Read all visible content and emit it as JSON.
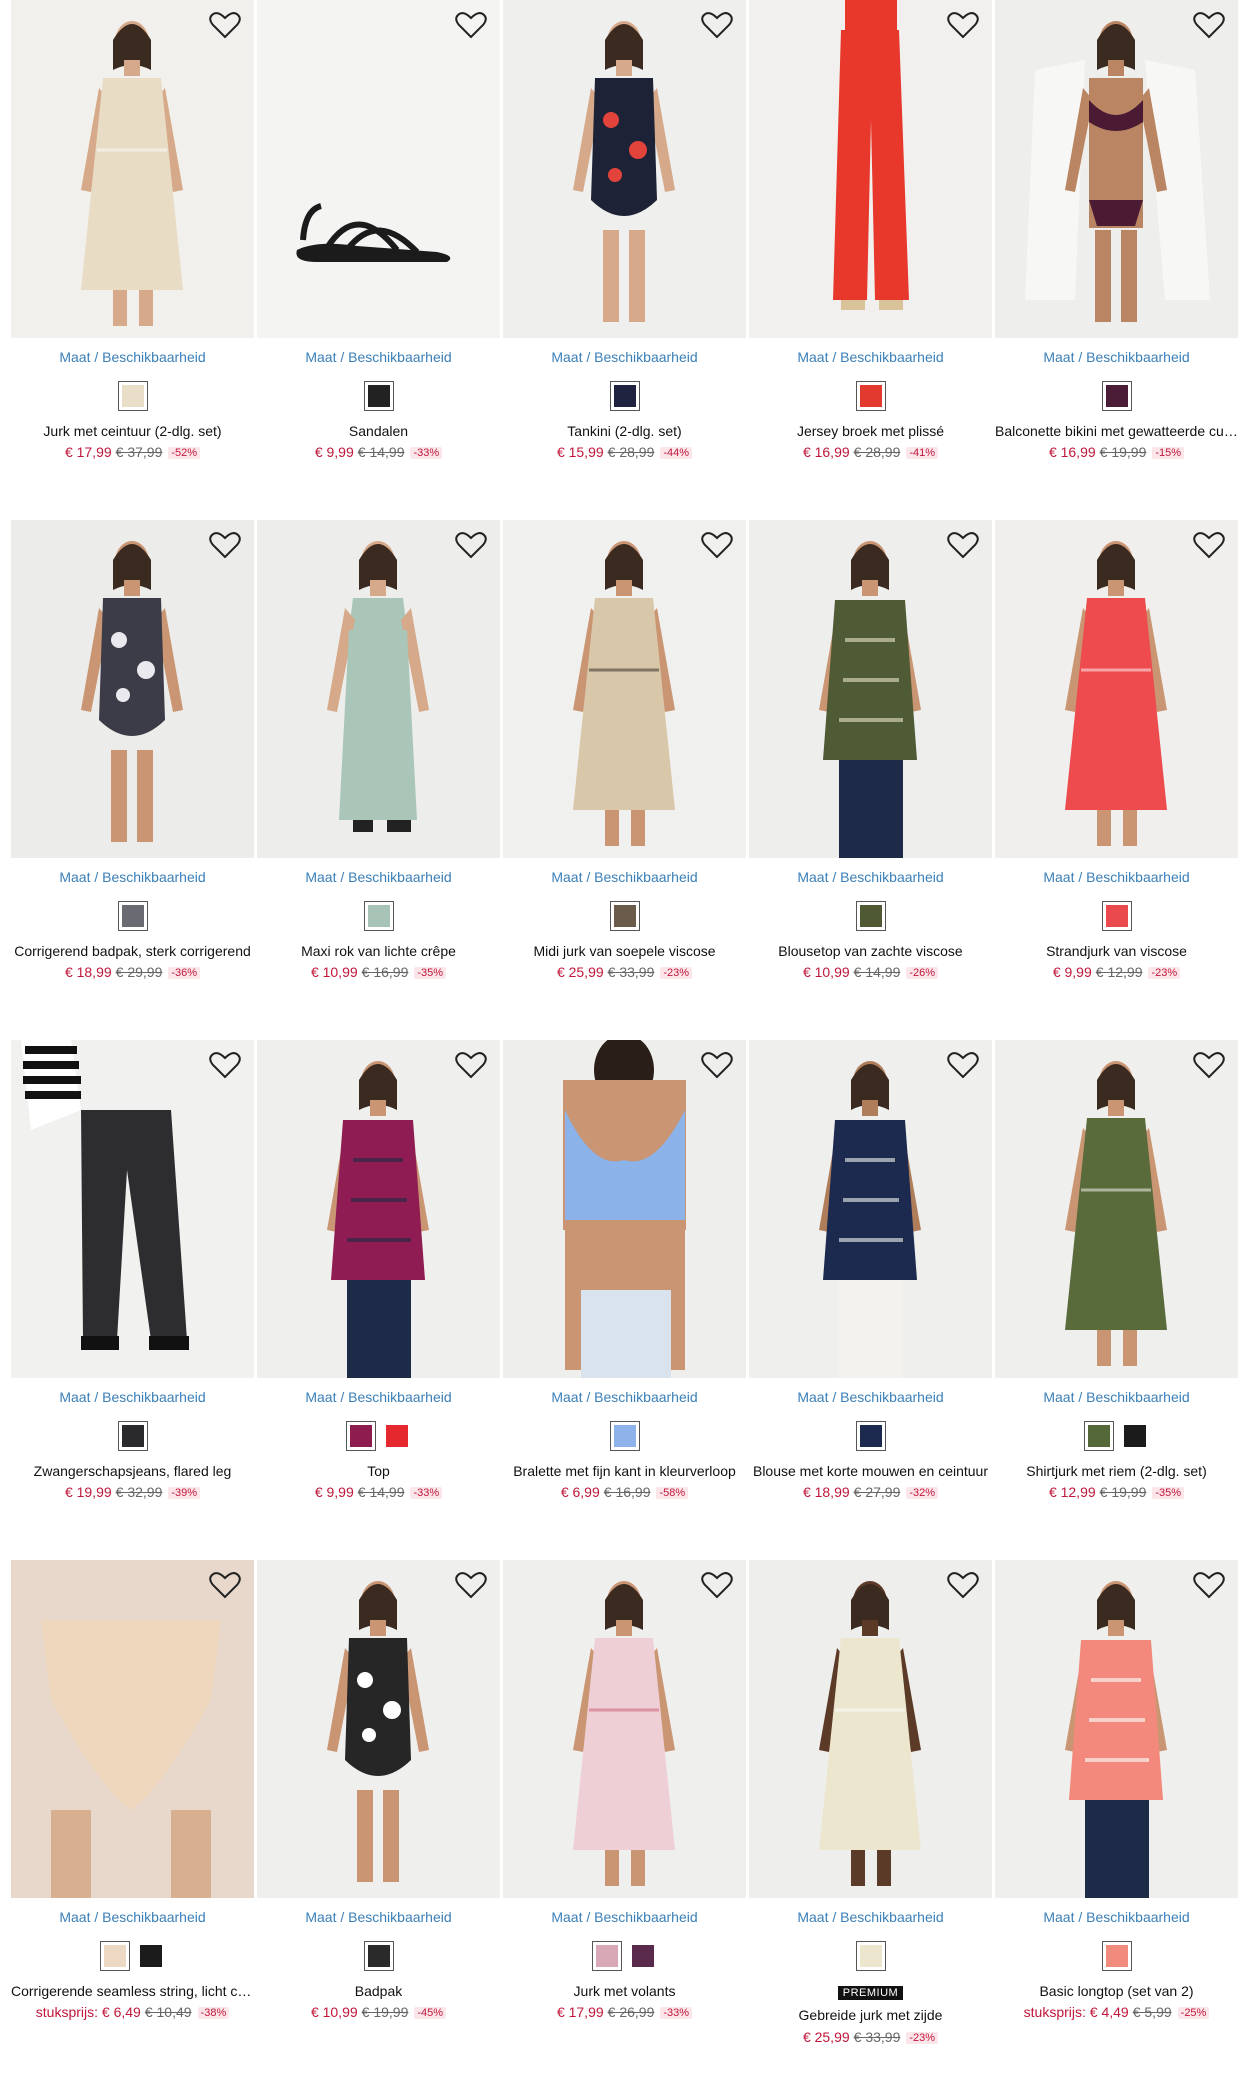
{
  "size_link_label": "Maat / Beschikbaarheid",
  "premium_label": "PREMIUM",
  "colors": {
    "price": "#c0173a",
    "link": "#3a7fb8",
    "discount_bg": "#fde6ea"
  },
  "products": [
    {
      "title": "Jurk met ceintuur (2-dlg. set)",
      "price": "€ 17,99",
      "was": "€ 37,99",
      "discount": "-52%",
      "swatches": [
        "#e9dfc9"
      ],
      "img": {
        "bg": "#f2f0ec",
        "garment": "#e8dcc4",
        "skin": "#d6a98a",
        "type": "dress"
      }
    },
    {
      "title": "Sandalen",
      "price": "€ 9,99",
      "was": "€ 14,99",
      "discount": "-33%",
      "swatches": [
        "#222222"
      ],
      "img": {
        "bg": "#f4f4f3",
        "garment": "#1b1b1b",
        "skin": "#d6a98a",
        "type": "sandal"
      }
    },
    {
      "title": "Tankini (2-dlg. set)",
      "price": "€ 15,99",
      "was": "€ 28,99",
      "discount": "-44%",
      "swatches": [
        "#1f2340"
      ],
      "img": {
        "bg": "#efefee",
        "garment": "#1e2236",
        "accent": "#e2433a",
        "skin": "#d6a98a",
        "type": "swim"
      }
    },
    {
      "title": "Jersey broek met plissé",
      "price": "€ 16,99",
      "was": "€ 28,99",
      "discount": "-41%",
      "swatches": [
        "#e23a2e"
      ],
      "img": {
        "bg": "#f1f0ee",
        "garment": "#e8382b",
        "skin": "#d6a98a",
        "type": "pants"
      }
    },
    {
      "title": "Balconette bikini met gewatteerde cups",
      "price": "€ 16,99",
      "was": "€ 19,99",
      "discount": "-15%",
      "swatches": [
        "#4b1c35"
      ],
      "img": {
        "bg": "#eeeeec",
        "garment": "#4a1b33",
        "accent": "#f7f7f5",
        "skin": "#b98563",
        "type": "bikini"
      }
    },
    {
      "title": "Corrigerend badpak, sterk corrigerend",
      "price": "€ 18,99",
      "was": "€ 29,99",
      "discount": "-36%",
      "swatches": [
        "#6a6a72"
      ],
      "img": {
        "bg": "#ececea",
        "garment": "#3c3c48",
        "accent": "#e9e9ee",
        "skin": "#c99573",
        "type": "swimsuit"
      }
    },
    {
      "title": "Maxi rok van lichte crêpe",
      "price": "€ 10,99",
      "was": "€ 16,99",
      "discount": "-35%",
      "swatches": [
        "#a7c4b6"
      ],
      "img": {
        "bg": "#edeeec",
        "garment": "#a9c6b8",
        "skin": "#d6a98a",
        "type": "skirt"
      }
    },
    {
      "title": "Midi jurk van soepele viscose",
      "price": "€ 25,99",
      "was": "€ 33,99",
      "discount": "-23%",
      "swatches": [
        "#6b5b4a"
      ],
      "img": {
        "bg": "#f0f0ee",
        "garment": "#d8c7a8",
        "accent": "#2b2520",
        "skin": "#c99573",
        "type": "dress"
      }
    },
    {
      "title": "Blousetop van zachte viscose",
      "price": "€ 10,99",
      "was": "€ 14,99",
      "discount": "-26%",
      "swatches": [
        "#4f5a35"
      ],
      "img": {
        "bg": "#eeeeec",
        "garment": "#4f5b35",
        "accent": "#e9e2c8",
        "skin": "#c99573",
        "type": "top"
      }
    },
    {
      "title": "Strandjurk van viscose",
      "price": "€ 9,99",
      "was": "€ 12,99",
      "discount": "-23%",
      "swatches": [
        "#ea4a4e"
      ],
      "img": {
        "bg": "#f0efed",
        "garment": "#ee4b4f",
        "skin": "#c99573",
        "type": "dress"
      }
    },
    {
      "title": "Zwangerschapsjeans, flared leg",
      "price": "€ 19,99",
      "was": "€ 32,99",
      "discount": "-39%",
      "swatches": [
        "#2a2a2c"
      ],
      "img": {
        "bg": "#f1f1f0",
        "garment": "#2d2d30",
        "accent": "#ffffff",
        "skin": "#d6a98a",
        "type": "jeans"
      }
    },
    {
      "title": "Top",
      "price": "€ 9,99",
      "was": "€ 14,99",
      "discount": "-33%",
      "swatches": [
        "#8e1c4f",
        "#e4282d"
      ],
      "img": {
        "bg": "#efefee",
        "garment": "#8f1c52",
        "accent": "#1d2a48",
        "skin": "#c99573",
        "type": "top"
      }
    },
    {
      "title": "Bralette met fijn kant in kleurverloop",
      "price": "€ 6,99",
      "was": "€ 16,99",
      "discount": "-58%",
      "swatches": [
        "#8db3ea"
      ],
      "img": {
        "bg": "#eeeeed",
        "garment": "#8cb2ea",
        "accent": "#d9e3ee",
        "skin": "#c99573",
        "type": "bra"
      }
    },
    {
      "title": "Blouse met korte mouwen en ceintuur",
      "price": "€ 18,99",
      "was": "€ 27,99",
      "discount": "-32%",
      "swatches": [
        "#1c2a4f"
      ],
      "img": {
        "bg": "#efefed",
        "garment": "#1c2a50",
        "accent": "#f4f2ee",
        "skin": "#b07d5b",
        "type": "blouse"
      }
    },
    {
      "title": "Shirtjurk met riem (2-dlg. set)",
      "price": "€ 12,99",
      "was": "€ 19,99",
      "discount": "-35%",
      "swatches": [
        "#55683a",
        "#1b1b1b"
      ],
      "img": {
        "bg": "#efefed",
        "garment": "#5a6b3b",
        "skin": "#c99573",
        "type": "dress"
      }
    },
    {
      "title": "Corrigerende seamless string, licht corrigerend",
      "unit_label": "stuksprijs:",
      "price": "€ 6,49",
      "was": "€ 10,49",
      "discount": "-38%",
      "swatches": [
        "#ecd8c3",
        "#1b1b1b"
      ],
      "img": {
        "bg": "#eeeeec",
        "garment": "#eed7bd",
        "skin": "#d9b08f",
        "type": "shapewear"
      }
    },
    {
      "title": "Badpak",
      "price": "€ 10,99",
      "was": "€ 19,99",
      "discount": "-45%",
      "swatches": [
        "#2a2a2a"
      ],
      "img": {
        "bg": "#efefee",
        "garment": "#262626",
        "skin": "#c99573",
        "type": "swimsuit"
      }
    },
    {
      "title": "Jurk met volants",
      "price": "€ 17,99",
      "was": "€ 26,99",
      "discount": "-33%",
      "swatches": [
        "#d9a8b6",
        "#5a2a4d"
      ],
      "img": {
        "bg": "#efefed",
        "garment": "#efcfd6",
        "accent": "#c9576f",
        "skin": "#c99573",
        "type": "dress"
      }
    },
    {
      "title": "Gebreide jurk met zijde",
      "premium": true,
      "price": "€ 25,99",
      "was": "€ 33,99",
      "discount": "-23%",
      "swatches": [
        "#ece6cf"
      ],
      "img": {
        "bg": "#eeeeec",
        "garment": "#ede6cf",
        "skin": "#5c3a28",
        "type": "dress"
      }
    },
    {
      "title": "Basic longtop (set van 2)",
      "unit_label": "stuksprijs:",
      "price": "€ 4,49",
      "was": "€ 5,99",
      "discount": "-25%",
      "swatches": [
        "#f08b7e"
      ],
      "img": {
        "bg": "#efefed",
        "garment": "#f2897c",
        "skin": "#c99573",
        "type": "top"
      }
    }
  ]
}
